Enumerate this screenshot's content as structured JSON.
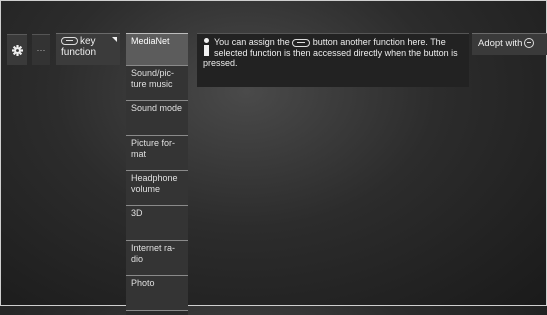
{
  "toolbar": {
    "settings_icon": "gear-icon",
    "ellipsis_label": "···",
    "key_function_label": "key function",
    "key_icon": "remote-key-oval-icon"
  },
  "menu": {
    "items": [
      {
        "label": "MediaNet",
        "selected": true
      },
      {
        "label": "Sound/pic-ture music",
        "selected": false
      },
      {
        "label": "Sound mode",
        "selected": false
      },
      {
        "label": "Picture for-mat",
        "selected": false
      },
      {
        "label": "Headphone volume",
        "selected": false
      },
      {
        "label": "3D",
        "selected": false
      },
      {
        "label": "Internet ra-dio",
        "selected": false
      },
      {
        "label": "Photo",
        "selected": false
      }
    ]
  },
  "info": {
    "text_before": "You can assign the",
    "text_after": "button another function here. The selected function is then accessed directly when the button is pressed.",
    "icon": "info-icon"
  },
  "adopt": {
    "label": "Adopt with",
    "icon": "ok-icon"
  },
  "colors": {
    "background": "#2c2c2c",
    "selected_item": "#5c5c5c",
    "text": "#e8e8e8"
  }
}
